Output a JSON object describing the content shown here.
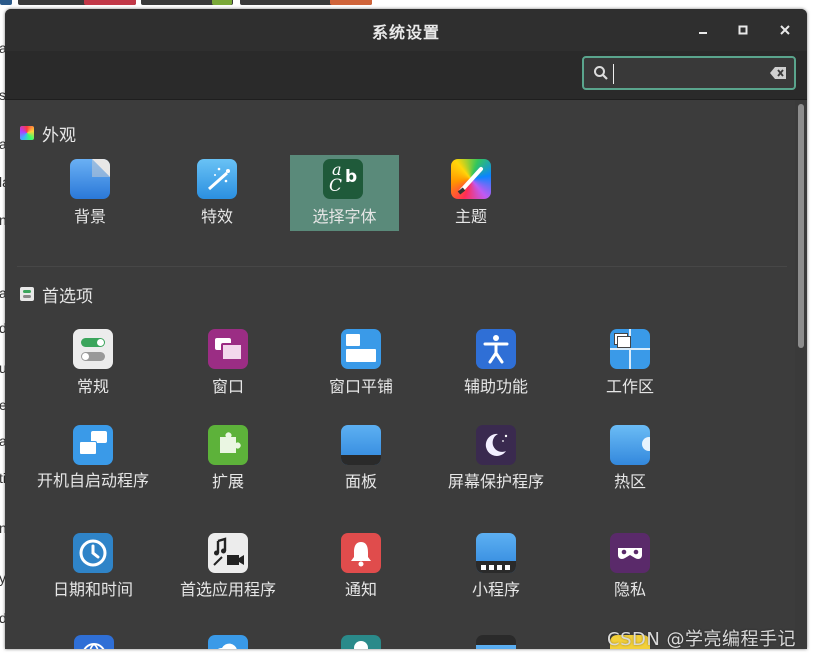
{
  "window": {
    "title": "系统设置",
    "minimize_label": "–",
    "maximize_label": "□",
    "close_label": "×"
  },
  "search": {
    "value": "",
    "placeholder": ""
  },
  "sections": [
    {
      "title": "外观",
      "items": [
        {
          "label": "背景",
          "icon": "background-icon"
        },
        {
          "label": "特效",
          "icon": "effects-icon"
        },
        {
          "label": "选择字体",
          "icon": "font-selection-icon",
          "selected": true
        },
        {
          "label": "主题",
          "icon": "themes-icon"
        }
      ]
    },
    {
      "title": "首选项",
      "items": [
        {
          "label": "常规",
          "icon": "general-icon"
        },
        {
          "label": "窗口",
          "icon": "windows-icon"
        },
        {
          "label": "窗口平铺",
          "icon": "window-tiling-icon"
        },
        {
          "label": "辅助功能",
          "icon": "accessibility-icon"
        },
        {
          "label": "工作区",
          "icon": "workspaces-icon"
        },
        {
          "label": "开机自启动程序",
          "icon": "startup-apps-icon"
        },
        {
          "label": "扩展",
          "icon": "extensions-icon"
        },
        {
          "label": "面板",
          "icon": "panel-icon"
        },
        {
          "label": "屏幕保护程序",
          "icon": "screensaver-icon"
        },
        {
          "label": "热区",
          "icon": "hot-corners-icon"
        },
        {
          "label": "日期和时间",
          "icon": "date-time-icon"
        },
        {
          "label": "首选应用程序",
          "icon": "preferred-apps-icon"
        },
        {
          "label": "通知",
          "icon": "notifications-icon"
        },
        {
          "label": "小程序",
          "icon": "applets-icon"
        },
        {
          "label": "隐私",
          "icon": "privacy-icon"
        }
      ]
    }
  ],
  "watermark": "CSDN @学亮编程手记",
  "background_letters": [
    "a",
    "s",
    "a",
    "la",
    "n",
    "a",
    "d",
    "u",
    "e",
    "al",
    "ti",
    "n",
    "y",
    "d"
  ],
  "colors": {
    "accent": "#5aa58d",
    "selected_bg": "#5a8a7a",
    "window_bg": "#3c3c3c",
    "titlebar_bg": "#2f2f2f"
  }
}
